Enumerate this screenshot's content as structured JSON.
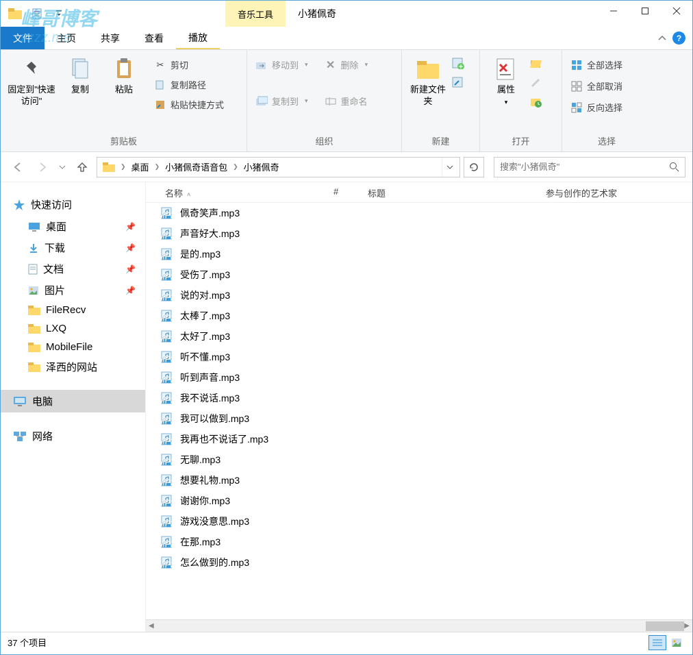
{
  "watermark": {
    "line1": "峰哥博客",
    "line2": "zzzz.me"
  },
  "titlebar": {
    "tool_tab": "音乐工具",
    "window_title": "小猪佩奇"
  },
  "menutabs": {
    "file": "文件",
    "home": "主页",
    "share": "共享",
    "view": "查看",
    "play": "播放"
  },
  "ribbon": {
    "clipboard": {
      "label": "剪贴板",
      "pin": "固定到\"快速访问\"",
      "copy": "复制",
      "paste": "粘贴",
      "cut": "剪切",
      "copy_path": "复制路径",
      "paste_shortcut": "粘贴快捷方式"
    },
    "organize": {
      "label": "组织",
      "move_to": "移动到",
      "copy_to": "复制到",
      "delete": "删除",
      "rename": "重命名"
    },
    "new": {
      "label": "新建",
      "new_folder": "新建文件夹"
    },
    "open": {
      "label": "打开",
      "properties": "属性"
    },
    "select": {
      "label": "选择",
      "select_all": "全部选择",
      "select_none": "全部取消",
      "invert": "反向选择"
    }
  },
  "breadcrumb": {
    "seg1": "桌面",
    "seg2": "小猪佩奇语音包",
    "seg3": "小猪佩奇"
  },
  "search": {
    "placeholder": "搜索\"小猪佩奇\""
  },
  "columns": {
    "name": "名称",
    "num": "#",
    "title": "标题",
    "artist": "参与创作的艺术家"
  },
  "sidebar": {
    "quick": "快速访问",
    "items": [
      {
        "label": "桌面",
        "pin": true
      },
      {
        "label": "下载",
        "pin": true
      },
      {
        "label": "文档",
        "pin": true
      },
      {
        "label": "图片",
        "pin": true
      },
      {
        "label": "FileRecv",
        "pin": false
      },
      {
        "label": "LXQ",
        "pin": false
      },
      {
        "label": "MobileFile",
        "pin": false
      },
      {
        "label": "泽西的网站",
        "pin": false
      }
    ],
    "computer": "电脑",
    "network": "网络"
  },
  "files": [
    "佩奇笑声.mp3",
    "声音好大.mp3",
    "是的.mp3",
    "受伤了.mp3",
    "说的对.mp3",
    "太棒了.mp3",
    "太好了.mp3",
    "听不懂.mp3",
    "听到声音.mp3",
    "我不说话.mp3",
    "我可以做到.mp3",
    "我再也不说话了.mp3",
    "无聊.mp3",
    "想要礼物.mp3",
    "谢谢你.mp3",
    "游戏没意思.mp3",
    "在那.mp3",
    "怎么做到的.mp3"
  ],
  "status": {
    "count": "37 个项目"
  }
}
